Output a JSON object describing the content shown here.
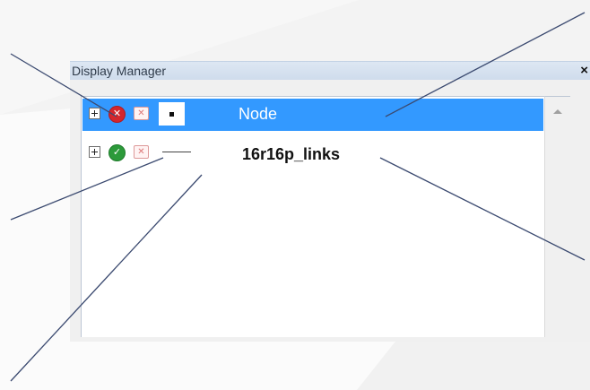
{
  "panel": {
    "title": "Display Manager",
    "close_label": "×"
  },
  "layers": [
    {
      "label": "Node",
      "expander_icon": "plus-expander-icon",
      "status_icon": "error-circle-icon",
      "status_glyph": "✕",
      "status_color": "#d4262d",
      "remove_icon": "remove-x-icon",
      "remove_glyph": "✕",
      "symbol": "point-symbol",
      "selected": true
    },
    {
      "label": "16r16p_links",
      "expander_icon": "plus-expander-icon",
      "status_icon": "check-circle-icon",
      "status_glyph": "✓",
      "status_color": "#2c9a3a",
      "remove_icon": "remove-x-icon",
      "remove_glyph": "✕",
      "symbol": "line-symbol",
      "selected": false
    }
  ],
  "colors": {
    "selection": "#3399ff",
    "callout_line": "#3b4a70",
    "title_bar": "#d6e2f0"
  }
}
